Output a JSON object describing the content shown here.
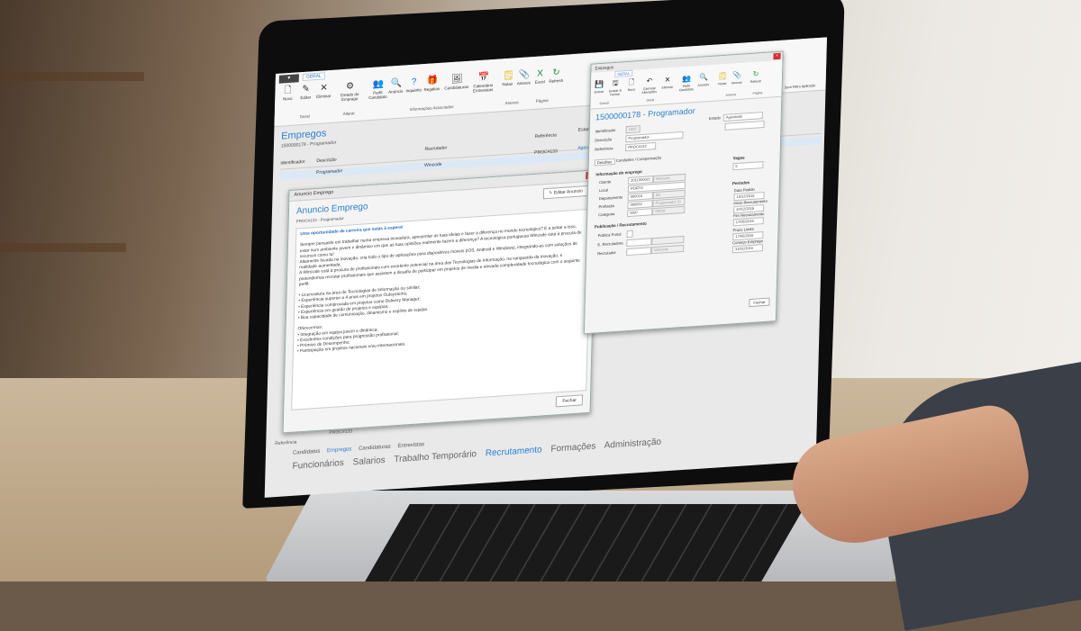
{
  "app": {
    "menu_label": "▾",
    "tab": "GERAL"
  },
  "toolbar": {
    "buttons": [
      {
        "label": "Novo",
        "icon": "new-doc-icon"
      },
      {
        "label": "Editar",
        "icon": "edit-icon"
      },
      {
        "label": "Eliminar",
        "icon": "delete-icon"
      },
      {
        "label": "Estado do Emprego",
        "icon": "status-icon"
      },
      {
        "label": "Perfil Candidato",
        "icon": "profile-icon"
      },
      {
        "label": "Anúncio",
        "icon": "announce-icon"
      },
      {
        "label": "Inquérito",
        "icon": "survey-icon"
      },
      {
        "label": "Regalias",
        "icon": "gift-icon"
      },
      {
        "label": "Candidaturas",
        "icon": "applications-icon"
      },
      {
        "label": "Calendário Entrevistas",
        "icon": "calendar-icon"
      },
      {
        "label": "Notas",
        "icon": "notes-icon"
      },
      {
        "label": "Anexos",
        "icon": "attach-icon"
      },
      {
        "label": "Excel",
        "icon": "excel-icon"
      },
      {
        "label": "Refresh",
        "icon": "refresh-icon"
      }
    ],
    "groups": [
      "Geral",
      "Alterar",
      "Informações Associadas",
      "Anexos",
      "Página"
    ]
  },
  "main": {
    "title": "Empregos",
    "subtitle": "1500000178 - Programador",
    "columns": [
      "Identificador",
      "Descrição",
      "Recrutador",
      "Referência",
      "Estado"
    ],
    "row": {
      "desc": "Programador",
      "recrutador": "Wincode",
      "ref": "PROC#133",
      "estado": "Agendado"
    }
  },
  "anuncio": {
    "title": "Anuncio Emprego",
    "heading": "Anuncio Emprego",
    "ref": "PROC#133 - Programador",
    "edit_label": "Editar Anuncio",
    "intro": "Uma oportunidade de carreira que estás à espera!",
    "p1": "Sempre pensaste em trabalhar numa empresa inovadora, apresentar as tuas ideias e fazer a diferença no mundo tecnológico? E a juntar a isso, estar num ambiente jovem e dinâmico em que as tuas opiniões realmente fazem a diferença? A tecnológica portuguesa Wincode está à procura de recursos como tu!",
    "p2": "Altamente focada na inovação, cria todo o tipo de aplicações para dispositivos móveis (iOS, Android e Windows), integrando-as com soluções de realidade aumentada.",
    "p3": "A Wincode está à procura de profissionais com excelente potencial na área das Tecnologias de Informação, na vanguarda da inovação, e pretendemos recrutar profissionais que assistem a desafio de participar em projetos de media e elevada complexidade tecnológica com o seguinte perfil:",
    "reqs": [
      "• Licenciatura na área de Tecnologias de Informação ou similar;",
      "• Experiência superior a 4 anos em projetos Outsystems;",
      "• Experiência comprovada em projetos como Delivery Manager;",
      "• Experiência em gestão de projetos e equipas;",
      "• Boa capacidade de comunicação, dinamismo e espírito de equipa."
    ],
    "offer_title": "Oferecemos:",
    "offers": [
      "• Integração em equipa jovem e dinâmica;",
      "• Excelentes condições para progressão profissional;",
      "• Prémios de Desempenho;",
      "• Participação em projetos nacionais e/ou internacionais."
    ],
    "close_label": "Fechar"
  },
  "detalhe": {
    "title": "Empregos",
    "tab": "GERAL",
    "heading": "1500000178 - Programador",
    "ribbon": [
      "Gravar",
      "Gravar & Fechar",
      "Novo",
      "Cancelar Alterações",
      "Eliminar",
      "Perfil Candidato",
      "Anúncio",
      "Notas",
      "Anexos",
      "Refresh"
    ],
    "ribbon_groups": [
      "Gravar",
      "Geral",
      "Anexos",
      "Página"
    ],
    "identificador_label": "Identificador",
    "identificador": "1500",
    "descricao_label": "Descrição",
    "descricao": "Programador",
    "referencia_label": "Referência",
    "referencia": "PROC#133",
    "estado_label": "Estado",
    "estado": "Agendado",
    "tabs": [
      "Detalhes",
      "Condições / Compensação"
    ],
    "info_title": "Informação do emprego",
    "cliente_label": "Cliente",
    "cliente_code": "2011000021",
    "cliente_name": "Wincode",
    "local_label": "Local",
    "local": "PORTO",
    "departamento_label": "Departamento",
    "departamento_code": "000016",
    "departamento_name": "SH",
    "profissao_label": "Profissão",
    "profissao_code": "000062",
    "profissao_name": "Programador Sr",
    "categoria_label": "Categoria",
    "categoria_code": "0007",
    "categoria_name": "Oficial",
    "pub_title": "Publicação / Recrutamento",
    "publica_label": "Pública Portal",
    "recrutadora_label": "E. Recrutadora",
    "recrutador_label": "Recrutador",
    "recrutador": "Wincode",
    "vagas_label": "Vagas",
    "vagas": "5",
    "periodos_label": "Períodos",
    "data_pedido_label": "Data Pedido",
    "data_pedido": "10/12/2015",
    "inicio_label": "Início Recrutamento",
    "inicio": "10/12/2015",
    "fim_label": "Fim Recrutamento",
    "fim": "17/05/2016",
    "prazo_label": "Prazo Limite",
    "prazo": "17/05/2016",
    "comeco_label": "Começo Emprego",
    "comeco": "31/01/2015",
    "close_label": "Fechar",
    "sem_filtro": "Sem Filtro Aplicado"
  },
  "nav": {
    "sub": [
      "Candidatos",
      "Empregos",
      "Candidaturas",
      "Entrevistas"
    ],
    "modules": [
      "Funcionários",
      "Salarios",
      "Trabalho Temporário",
      "Recrutamento",
      "Formações",
      "Administração"
    ]
  },
  "footer_row": {
    "label": "Referência",
    "value": "PROC#133"
  }
}
